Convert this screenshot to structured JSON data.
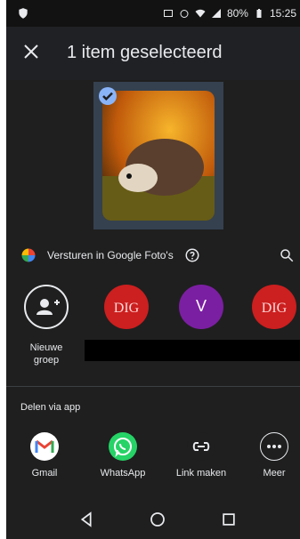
{
  "status_bar": {
    "battery_percent": "80%",
    "time": "15:25",
    "icons": [
      "shield-icon",
      "cast-icon",
      "alarm-icon",
      "wifi-icon",
      "signal-icon",
      "battery-icon"
    ]
  },
  "app_bar": {
    "title": "1 item geselecteerd",
    "close_icon": "close-icon"
  },
  "preview": {
    "check_icon": "check-icon",
    "selected": true
  },
  "photos_row": {
    "label": "Versturen in Google Foto's",
    "help_icon": "help-icon",
    "search_icon": "search-icon",
    "photos_icon": "google-photos-pinwheel-icon"
  },
  "contacts": [
    {
      "type": "new-group",
      "label": "Nieuwe groep",
      "icon": "add-group-icon"
    },
    {
      "type": "dig",
      "text": "DIG"
    },
    {
      "type": "v",
      "text": "V"
    },
    {
      "type": "dig",
      "text": "DIG"
    }
  ],
  "share_via_app": {
    "title": "Delen via app",
    "apps": [
      {
        "label": "Gmail",
        "icon": "gmail-icon"
      },
      {
        "label": "WhatsApp",
        "icon": "whatsapp-icon"
      },
      {
        "label": "Link maken",
        "icon": "link-icon"
      },
      {
        "label": "Meer",
        "icon": "more-icon"
      }
    ]
  },
  "nav_bar": {
    "buttons": [
      "back-icon",
      "home-icon",
      "recents-icon"
    ]
  },
  "colors": {
    "background": "#1f1f1f",
    "appbar": "#202124",
    "statusbar": "#121212",
    "accent_check": "#8ab4f8",
    "whatsapp": "#25d366",
    "v_avatar": "#7b1fa2",
    "dig_avatar": "#cc1f1f"
  }
}
